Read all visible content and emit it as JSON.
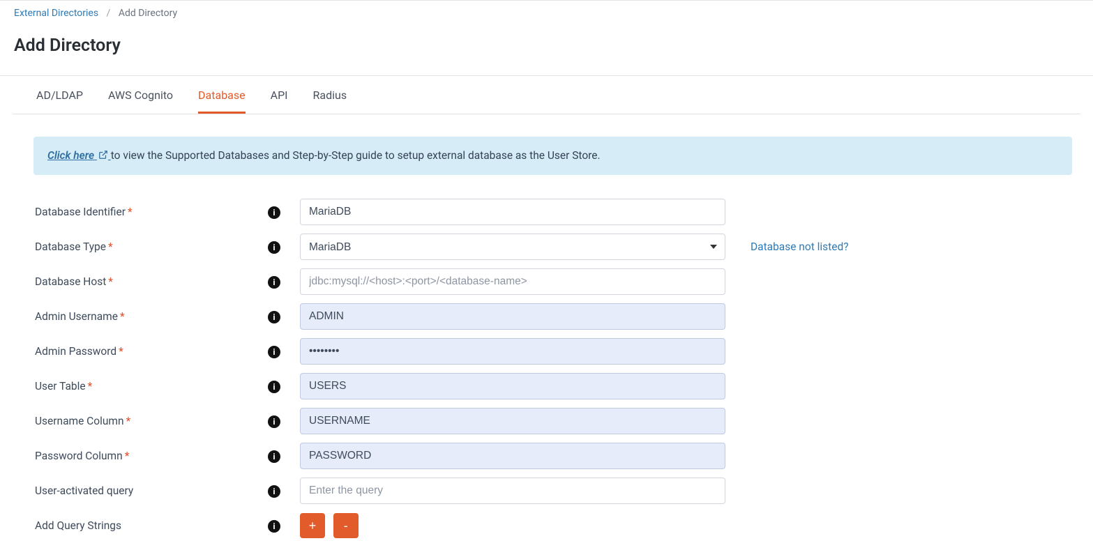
{
  "breadcrumb": {
    "parent": "External Directories",
    "current": "Add Directory"
  },
  "page_title": "Add Directory",
  "tabs": {
    "adldap": "AD/LDAP",
    "cognito": "AWS Cognito",
    "database": "Database",
    "api": "API",
    "radius": "Radius"
  },
  "info_banner": {
    "link_text": "Click here",
    "rest_text": " to view the Supported Databases and Step-by-Step guide to setup external database as the User Store."
  },
  "labels": {
    "db_identifier": "Database Identifier",
    "db_type": "Database Type",
    "db_host": "Database Host",
    "admin_user": "Admin Username",
    "admin_pass": "Admin Password",
    "user_table": "User Table",
    "username_col": "Username Column",
    "password_col": "Password Column",
    "user_activated_query": "User-activated query",
    "add_query_strings": "Add Query Strings"
  },
  "values": {
    "db_identifier": "MariaDB",
    "db_type_selected": "MariaDB",
    "db_host": "",
    "admin_user": "ADMIN",
    "admin_pass": "••••••••",
    "user_table": "USERS",
    "username_col": "USERNAME",
    "password_col": "PASSWORD",
    "user_activated_query": ""
  },
  "placeholders": {
    "db_host": "jdbc:mysql://<host>:<port>/<database-name>",
    "user_activated_query": "Enter the query"
  },
  "side_link": "Database not listed?",
  "buttons": {
    "add": "+",
    "remove": "-"
  }
}
